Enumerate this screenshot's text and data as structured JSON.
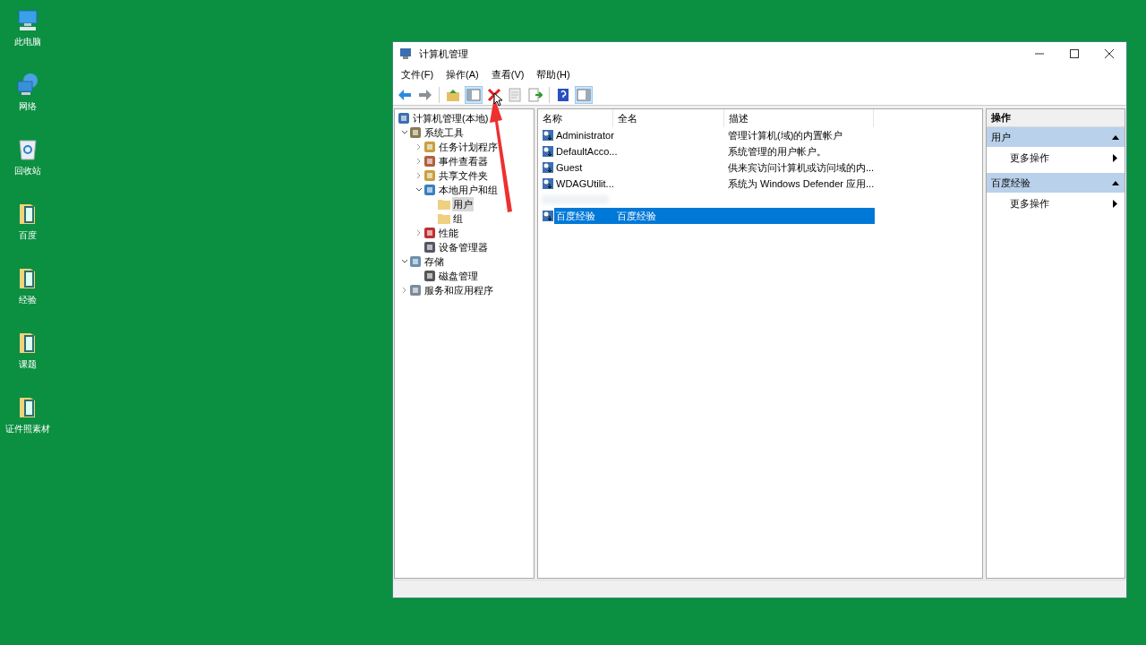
{
  "desktop_icons": [
    {
      "label": "此电脑",
      "kind": "computer"
    },
    {
      "label": "网络",
      "kind": "network"
    },
    {
      "label": "回收站",
      "kind": "recycle"
    },
    {
      "label": "百度",
      "kind": "folder"
    },
    {
      "label": "经验",
      "kind": "folder"
    },
    {
      "label": "课题",
      "kind": "folder"
    },
    {
      "label": "证件照素材",
      "kind": "folder"
    }
  ],
  "window": {
    "title": "计算机管理"
  },
  "menu": [
    "文件(F)",
    "操作(A)",
    "查看(V)",
    "帮助(H)"
  ],
  "toolbar": [
    {
      "kind": "back",
      "pressed": false
    },
    {
      "kind": "forward",
      "pressed": false
    },
    {
      "kind": "separator"
    },
    {
      "kind": "up",
      "pressed": false
    },
    {
      "kind": "tree",
      "pressed": true
    },
    {
      "kind": "delete",
      "pressed": false
    },
    {
      "kind": "properties",
      "pressed": false
    },
    {
      "kind": "export",
      "pressed": false
    },
    {
      "kind": "separator"
    },
    {
      "kind": "help",
      "pressed": false
    },
    {
      "kind": "pane",
      "pressed": true
    }
  ],
  "tree": [
    {
      "label": "计算机管理(本地)",
      "kind": "computer",
      "selected": false,
      "children": [
        {
          "label": "系统工具",
          "kind": "tools",
          "expanded": true,
          "selected": false,
          "children": [
            {
              "label": "任务计划程序",
              "kind": "clock",
              "expanded": false,
              "selected": false
            },
            {
              "label": "事件查看器",
              "kind": "event",
              "expanded": false,
              "selected": false
            },
            {
              "label": "共享文件夹",
              "kind": "share",
              "expanded": false,
              "selected": false
            },
            {
              "label": "本地用户和组",
              "kind": "users",
              "expanded": true,
              "selected": false,
              "children": [
                {
                  "label": "用户",
                  "kind": "folder",
                  "selected": true
                },
                {
                  "label": "组",
                  "kind": "folder",
                  "selected": false
                }
              ]
            },
            {
              "label": "性能",
              "kind": "perf",
              "expanded": false,
              "selected": false
            },
            {
              "label": "设备管理器",
              "kind": "device",
              "selected": false
            }
          ]
        },
        {
          "label": "存储",
          "kind": "storage",
          "expanded": true,
          "selected": false,
          "children": [
            {
              "label": "磁盘管理",
              "kind": "disk",
              "selected": false
            }
          ]
        },
        {
          "label": "服务和应用程序",
          "kind": "services",
          "expanded": false,
          "selected": false
        }
      ]
    }
  ],
  "table": {
    "columns": [
      "名称",
      "全名",
      "描述"
    ],
    "rows": [
      {
        "name": "Administrator",
        "full_name": "",
        "description": "管理计算机(域)的内置帐户",
        "selected": false,
        "kind": "user"
      },
      {
        "name": "DefaultAcco...",
        "full_name": "",
        "description": "系统管理的用户帐户。",
        "selected": false,
        "kind": "user"
      },
      {
        "name": "Guest",
        "full_name": "",
        "description": "供来宾访问计算机或访问域的内...",
        "selected": false,
        "kind": "user"
      },
      {
        "name": "WDAGUtilit...",
        "full_name": "",
        "description": "系统为 Windows Defender 应用...",
        "selected": false,
        "kind": "user"
      },
      {
        "kind": "blurred",
        "selected": false
      },
      {
        "name": "百度经验",
        "full_name": "百度经验",
        "description": "",
        "selected": true,
        "kind": "user"
      }
    ]
  },
  "actions": {
    "title": "操作",
    "sections": [
      {
        "title": "用户",
        "items": [
          "更多操作"
        ]
      },
      {
        "title": "百度经验",
        "items": [
          "更多操作"
        ]
      }
    ]
  }
}
